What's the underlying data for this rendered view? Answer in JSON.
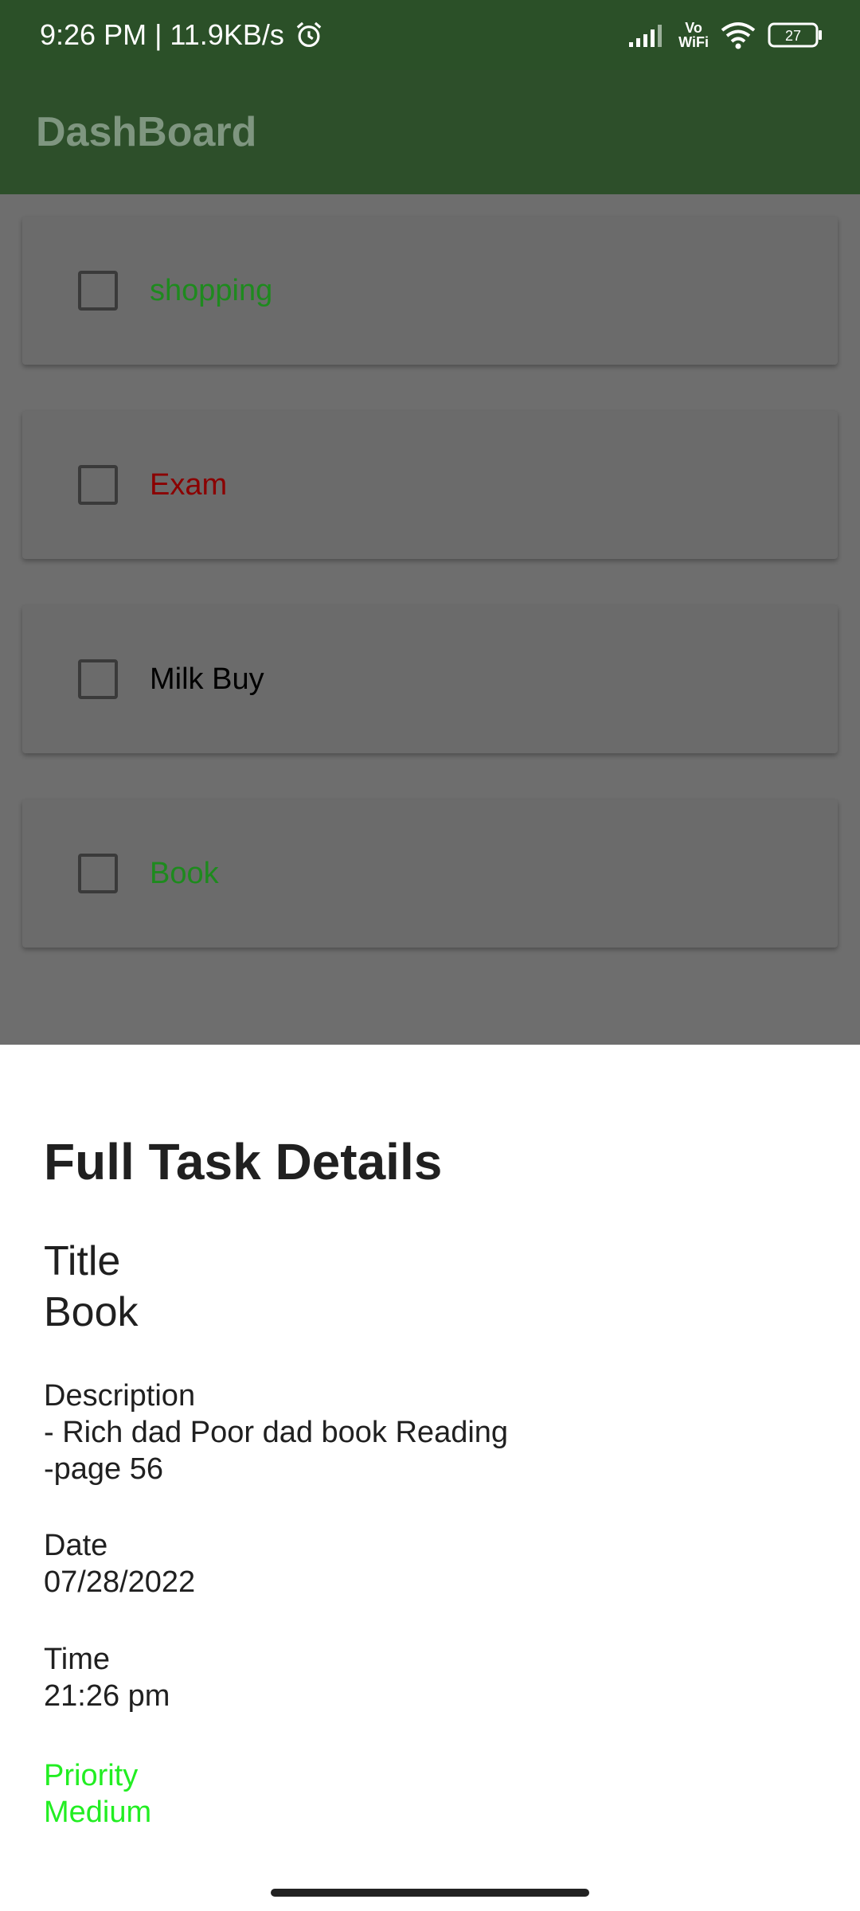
{
  "status_bar": {
    "time_speed": "9:26 PM | 11.9KB/s",
    "network_label_top": "Vo",
    "network_label_bottom": "WiFi",
    "battery": "27"
  },
  "app_bar": {
    "title": "DashBoard"
  },
  "tasks": [
    {
      "title": "shopping",
      "color": "#1e8a1e"
    },
    {
      "title": "Exam",
      "color": "#8b0000"
    },
    {
      "title": "Milk Buy",
      "color": "#000000"
    },
    {
      "title": "Book",
      "color": "#1e8a1e"
    }
  ],
  "sheet": {
    "heading": "Full Task Details",
    "title_label": "Title",
    "title_value": "Book",
    "description_label": "Description",
    "description_lines": [
      "- Rich dad Poor dad book Reading",
      "-page 56"
    ],
    "date_label": "Date",
    "date_value": "07/28/2022",
    "time_label": "Time",
    "time_value": "21:26 pm",
    "priority_label": "Priority",
    "priority_value": "Medium",
    "priority_color": "#22ee22"
  }
}
